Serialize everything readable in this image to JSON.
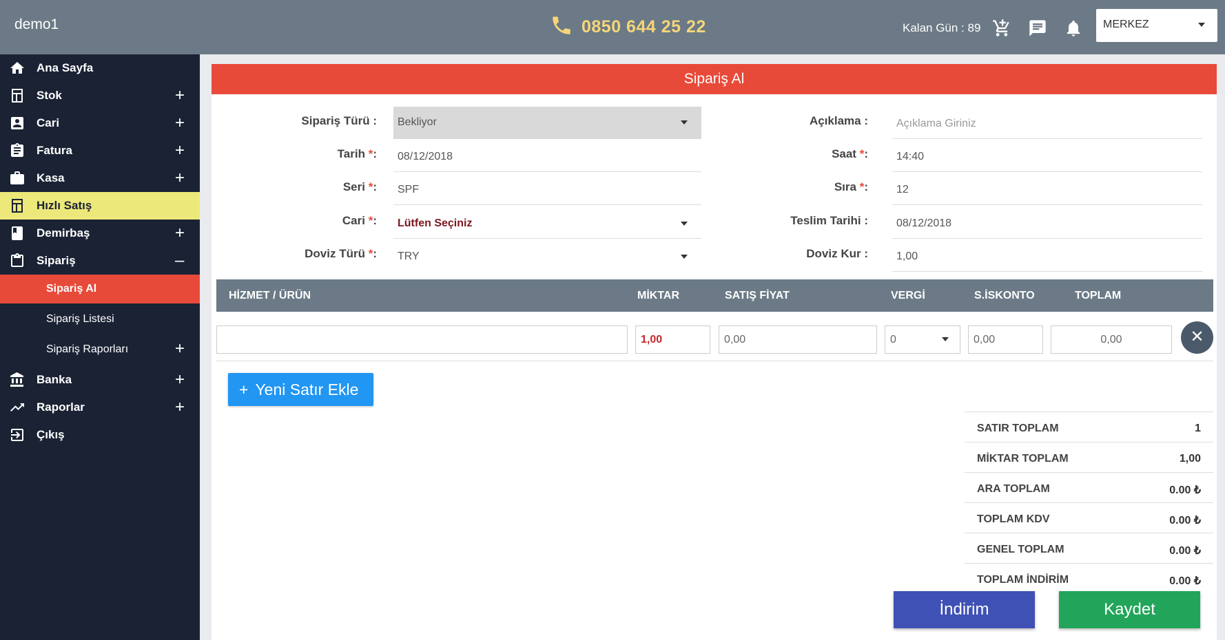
{
  "topbar": {
    "brand": "demo1",
    "phone": "0850 644 25 22",
    "remaining_days": "Kalan Gün : 89",
    "branch": "MERKEZ",
    "colors": {
      "bar": "#6b7a86",
      "phone": "#f6d57a"
    }
  },
  "sidebar": {
    "items": [
      {
        "label": "Ana Sayfa",
        "icon": "home-icon",
        "expandable": false
      },
      {
        "label": "Stok",
        "icon": "stock-icon",
        "expandable": true
      },
      {
        "label": "Cari",
        "icon": "account-icon",
        "expandable": true
      },
      {
        "label": "Fatura",
        "icon": "invoice-icon",
        "expandable": true
      },
      {
        "label": "Kasa",
        "icon": "briefcase-icon",
        "expandable": true
      },
      {
        "label": "Hızlı Satış",
        "icon": "calculator-icon",
        "expandable": false,
        "active": true
      },
      {
        "label": "Demirbaş",
        "icon": "book-icon",
        "expandable": true
      },
      {
        "label": "Sipariş",
        "icon": "clipboard-icon",
        "expandable": true,
        "expanded": true
      },
      {
        "label": "Banka",
        "icon": "bank-icon",
        "expandable": true
      },
      {
        "label": "Raporlar",
        "icon": "trending-up-icon",
        "expandable": true
      },
      {
        "label": "Çıkış",
        "icon": "logout-icon",
        "expandable": false
      }
    ],
    "sub_items": [
      {
        "label": "Sipariş Al",
        "current": true
      },
      {
        "label": "Sipariş Listesi"
      },
      {
        "label": "Sipariş Raporları",
        "expandable": true
      }
    ],
    "plus": "+",
    "minus": "–"
  },
  "form": {
    "title": "Sipariş Al",
    "left": {
      "order_type": {
        "label": "Sipariş Türü :",
        "value": "Bekliyor"
      },
      "date": {
        "label": "Tarih ",
        "required": "*",
        "suffix": ":",
        "value": "08/12/2018"
      },
      "series": {
        "label": "Seri ",
        "required": "*",
        "suffix": ":",
        "value": "SPF"
      },
      "account": {
        "label": "Cari ",
        "required": "*",
        "suffix": ":",
        "value": "Lütfen Seçiniz"
      },
      "currency": {
        "label": "Doviz Türü ",
        "required": "*",
        "suffix": ":",
        "value": "TRY"
      }
    },
    "right": {
      "description": {
        "label": "Açıklama :",
        "placeholder": "Açıklama Giriniz"
      },
      "time": {
        "label": "Saat ",
        "required": "*",
        "suffix": ":",
        "value": "14:40"
      },
      "sequence": {
        "label": "Sıra ",
        "required": "*",
        "suffix": ":",
        "value": "12"
      },
      "delivery_date": {
        "label": "Teslim Tarihi :",
        "value": "08/12/2018"
      },
      "exchange_rate": {
        "label": "Doviz Kur :",
        "value": "1,00"
      }
    }
  },
  "table": {
    "headers": [
      "HİZMET / ÜRÜN",
      "MİKTAR",
      "SATIŞ FİYAT",
      "VERGİ",
      "S.İSKONTO",
      "TOPLAM"
    ],
    "row": {
      "product": "",
      "quantity": "1,00",
      "price": "0,00",
      "tax": "0",
      "discount": "0,00",
      "total": "0,00"
    },
    "remove": "✕"
  },
  "add_row": {
    "plus": "+",
    "label": "Yeni Satır Ekle"
  },
  "summary": [
    {
      "label": "SATIR TOPLAM",
      "value": "1"
    },
    {
      "label": "MİKTAR TOPLAM",
      "value": "1,00"
    },
    {
      "label": "ARA TOPLAM",
      "value": "0.00 ₺"
    },
    {
      "label": "TOPLAM KDV",
      "value": "0.00 ₺"
    },
    {
      "label": "GENEL TOPLAM",
      "value": "0.00 ₺"
    },
    {
      "label": "TOPLAM İNDİRİM",
      "value": "0.00 ₺"
    }
  ],
  "actions": {
    "discount": "İndirim",
    "save": "Kaydet"
  }
}
